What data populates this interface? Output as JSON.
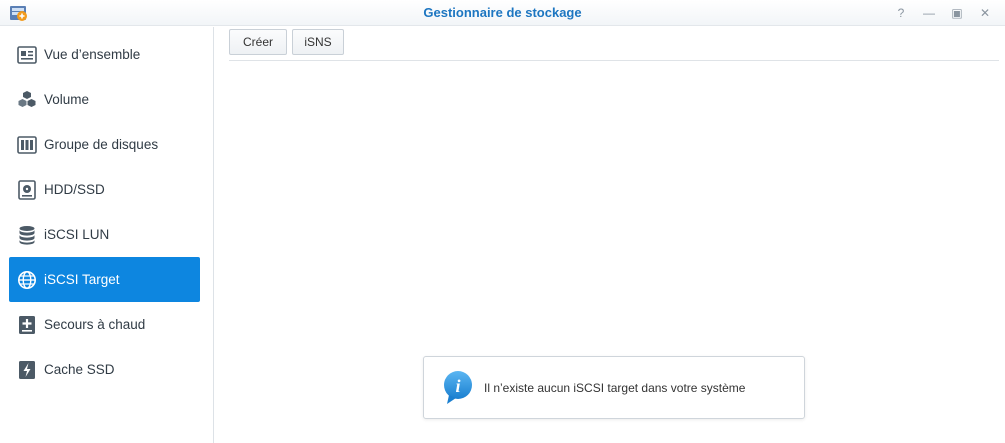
{
  "window": {
    "title": "Gestionnaire de stockage",
    "help_glyph": "?",
    "minimize_glyph": "—",
    "maximize_glyph": "▣",
    "close_glyph": "✕"
  },
  "sidebar": {
    "items": [
      {
        "label": "Vue d’ensemble",
        "icon": "overview-icon",
        "active": false
      },
      {
        "label": "Volume",
        "icon": "volume-cubes-icon",
        "active": false
      },
      {
        "label": "Groupe de disques",
        "icon": "disk-group-icon",
        "active": false
      },
      {
        "label": "HDD/SSD",
        "icon": "hdd-icon",
        "active": false
      },
      {
        "label": "iSCSI LUN",
        "icon": "database-icon",
        "active": false
      },
      {
        "label": "iSCSI Target",
        "icon": "globe-icon",
        "active": true
      },
      {
        "label": "Secours à chaud",
        "icon": "hot-spare-icon",
        "active": false
      },
      {
        "label": "Cache SSD",
        "icon": "ssd-cache-icon",
        "active": false
      }
    ]
  },
  "toolbar": {
    "create_label": "Créer",
    "isns_label": "iSNS"
  },
  "notice": {
    "message": "Il n’existe aucun iSCSI target dans votre système"
  },
  "colors": {
    "accent": "#0d86e0",
    "title": "#1d76c1"
  }
}
